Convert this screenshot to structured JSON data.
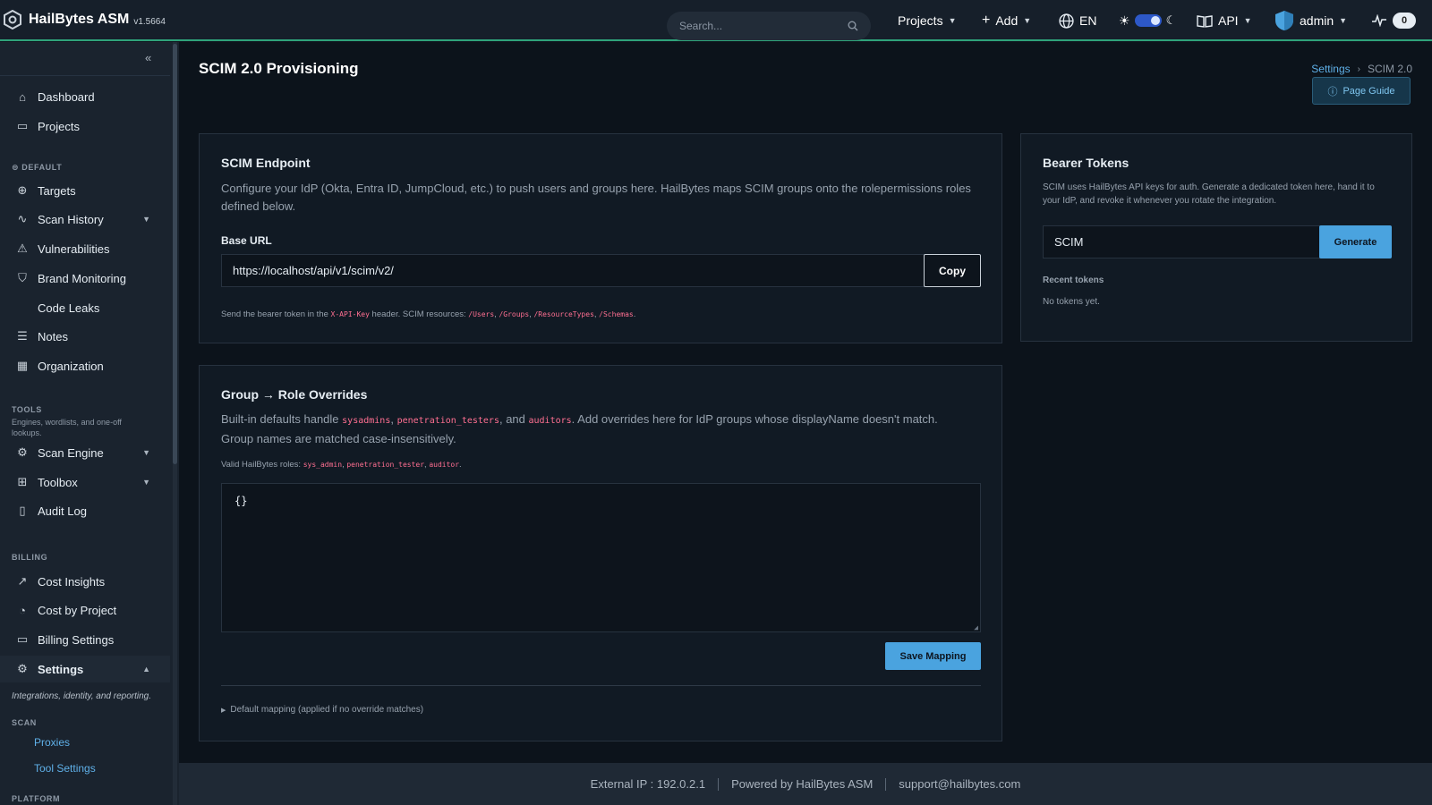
{
  "app": {
    "name": "HailBytes ASM",
    "version": "v1.5664"
  },
  "topbar": {
    "search_placeholder": "Search...",
    "projects": "Projects",
    "add": "Add",
    "language": "EN",
    "api": "API",
    "user": "admin",
    "notifications": "0"
  },
  "sidebar": {
    "top_items": [
      {
        "label": "Dashboard",
        "icon": "home-icon"
      },
      {
        "label": "Projects",
        "icon": "folder-icon"
      }
    ],
    "default_section": "DEFAULT",
    "default_items": [
      {
        "label": "Targets",
        "icon": "crosshair-icon"
      },
      {
        "label": "Scan History",
        "icon": "activity-icon"
      },
      {
        "label": "Vulnerabilities",
        "icon": "warning-icon"
      },
      {
        "label": "Brand Monitoring",
        "icon": "shield-icon"
      },
      {
        "label": "Code Leaks",
        "icon": ""
      },
      {
        "label": "Notes",
        "icon": "note-icon"
      },
      {
        "label": "Organization",
        "icon": "building-icon"
      }
    ],
    "tools_section": "TOOLS",
    "tools_desc": "Engines, wordlists, and one-off lookups.",
    "tools_items": [
      {
        "label": "Scan Engine",
        "icon": "gear-icon"
      },
      {
        "label": "Toolbox",
        "icon": "grid-icon"
      },
      {
        "label": "Audit Log",
        "icon": "clipboard-icon"
      }
    ],
    "billing_section": "BILLING",
    "billing_items": [
      {
        "label": "Cost Insights",
        "icon": "trend-icon"
      },
      {
        "label": "Cost by Project",
        "icon": "pie-icon"
      },
      {
        "label": "Billing Settings",
        "icon": "card-icon"
      }
    ],
    "settings_label": "Settings",
    "settings_desc": "Integrations, identity, and reporting.",
    "scan_section": "SCAN",
    "scan_items": [
      "Proxies",
      "Tool Settings"
    ],
    "platform_section": "PLATFORM"
  },
  "page": {
    "title": "SCIM 2.0 Provisioning",
    "breadcrumb": [
      "Settings",
      "SCIM 2.0"
    ],
    "guide_button": "Page Guide"
  },
  "endpoint_card": {
    "title": "SCIM Endpoint",
    "description": "Configure your IdP (Okta, Entra ID, JumpCloud, etc.) to push users and groups here. HailBytes maps SCIM groups onto the rolepermissions roles defined below.",
    "base_url_label": "Base URL",
    "base_url": "https://localhost/api/v1/scim/v2/",
    "copy_button": "Copy",
    "help_prefix": "Send the bearer token in the",
    "help_header": "X-API-Key",
    "help_middle": "header. SCIM resources:",
    "help_resources": [
      "/Users",
      "/Groups",
      "/ResourceTypes",
      "/Schemas"
    ]
  },
  "tokens_card": {
    "title": "Bearer Tokens",
    "description": "SCIM uses HailBytes API keys for auth. Generate a dedicated token here, hand it to your IdP, and revoke it whenever you rotate the integration.",
    "token_name": "SCIM",
    "generate_button": "Generate",
    "recent_label": "Recent tokens",
    "empty": "No tokens yet."
  },
  "overrides_card": {
    "title": "Group → Role Overrides",
    "desc_prefix": "Built-in defaults handle",
    "defaults": [
      "sysadmins",
      "penetration_testers",
      "auditors"
    ],
    "desc_suffix": ". Add overrides here for IdP groups whose displayName doesn't match. Group names are matched case-insensitively.",
    "valid_prefix": "Valid HailBytes roles:",
    "valid_roles": [
      "sys_admin",
      "penetration_tester",
      "auditor"
    ],
    "textarea_value": "{}",
    "save_button": "Save Mapping",
    "default_mapping": "Default mapping (applied if no override matches)"
  },
  "footer": {
    "external_ip": "External IP : 192.0.2.1",
    "powered": "Powered by HailBytes ASM",
    "support": "support@hailbytes.com"
  },
  "colors": {
    "accent": "#4aa3df",
    "topbar_border": "#2fa37a",
    "code": "#ff6f91"
  }
}
